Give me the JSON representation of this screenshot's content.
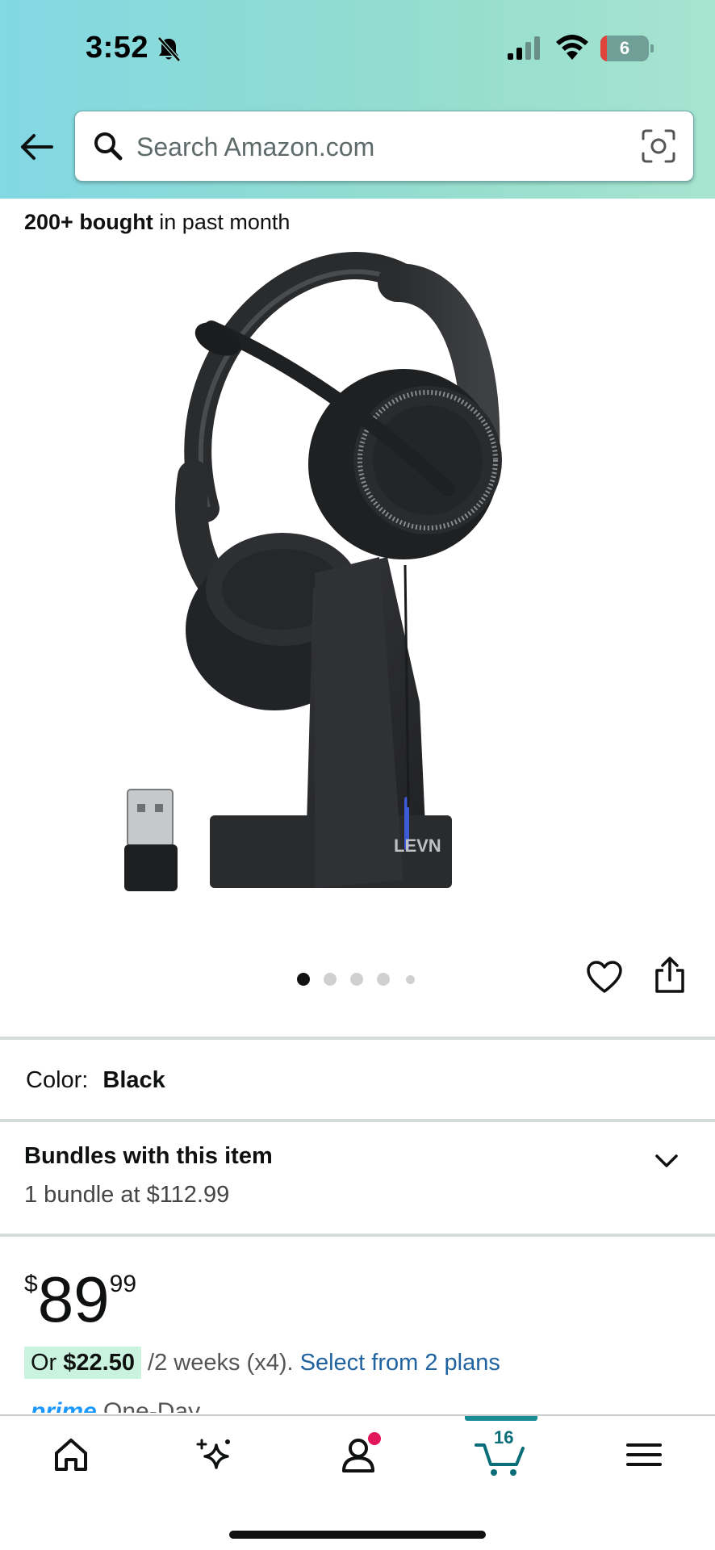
{
  "status_bar": {
    "time": "3:52",
    "battery_level": "6",
    "icons": [
      "bell-slash-icon",
      "signal-icon",
      "wifi-icon",
      "battery-icon"
    ]
  },
  "header": {
    "back_icon": "arrow-left-icon",
    "search": {
      "placeholder": "Search Amazon.com",
      "value": ""
    },
    "camera_icon": "camera-lens-icon"
  },
  "colors": {
    "header_gradient_start": "#82d8e3",
    "header_gradient_end": "#a6e4cf",
    "link": "#2162a1",
    "installment_badge": "#c9f2df",
    "cart_accent": "#1a8c95",
    "notification_dot": "#e2175b",
    "prime_blue": "#1a98ff"
  },
  "product": {
    "bought": {
      "strong": "200+ bought",
      "rest": " in past month"
    },
    "image_name": "headset-with-charging-stand-image",
    "brand_mark": "LEVN",
    "carousel": {
      "count": 5,
      "active": 1
    },
    "color": {
      "label": "Color:",
      "value": "Black"
    },
    "bundles": {
      "title": "Bundles with this item",
      "subtitle": "1 bundle at $112.99"
    },
    "price": {
      "symbol": "$",
      "whole": "89",
      "fraction": "99"
    },
    "installment": {
      "prefix": "Or ",
      "amount": "$22.50",
      "rest": " /2 weeks (x4). ",
      "link": "Select from 2 plans"
    },
    "prime": {
      "brand": "prime",
      "rest": " One-Day"
    }
  },
  "bottom_nav": {
    "items": [
      {
        "name": "home",
        "icon": "home-icon"
      },
      {
        "name": "ai",
        "icon": "sparkle-icon"
      },
      {
        "name": "account",
        "icon": "person-icon"
      },
      {
        "name": "cart",
        "icon": "cart-icon"
      },
      {
        "name": "menu",
        "icon": "hamburger-menu-icon"
      }
    ],
    "cart_count": "16"
  }
}
